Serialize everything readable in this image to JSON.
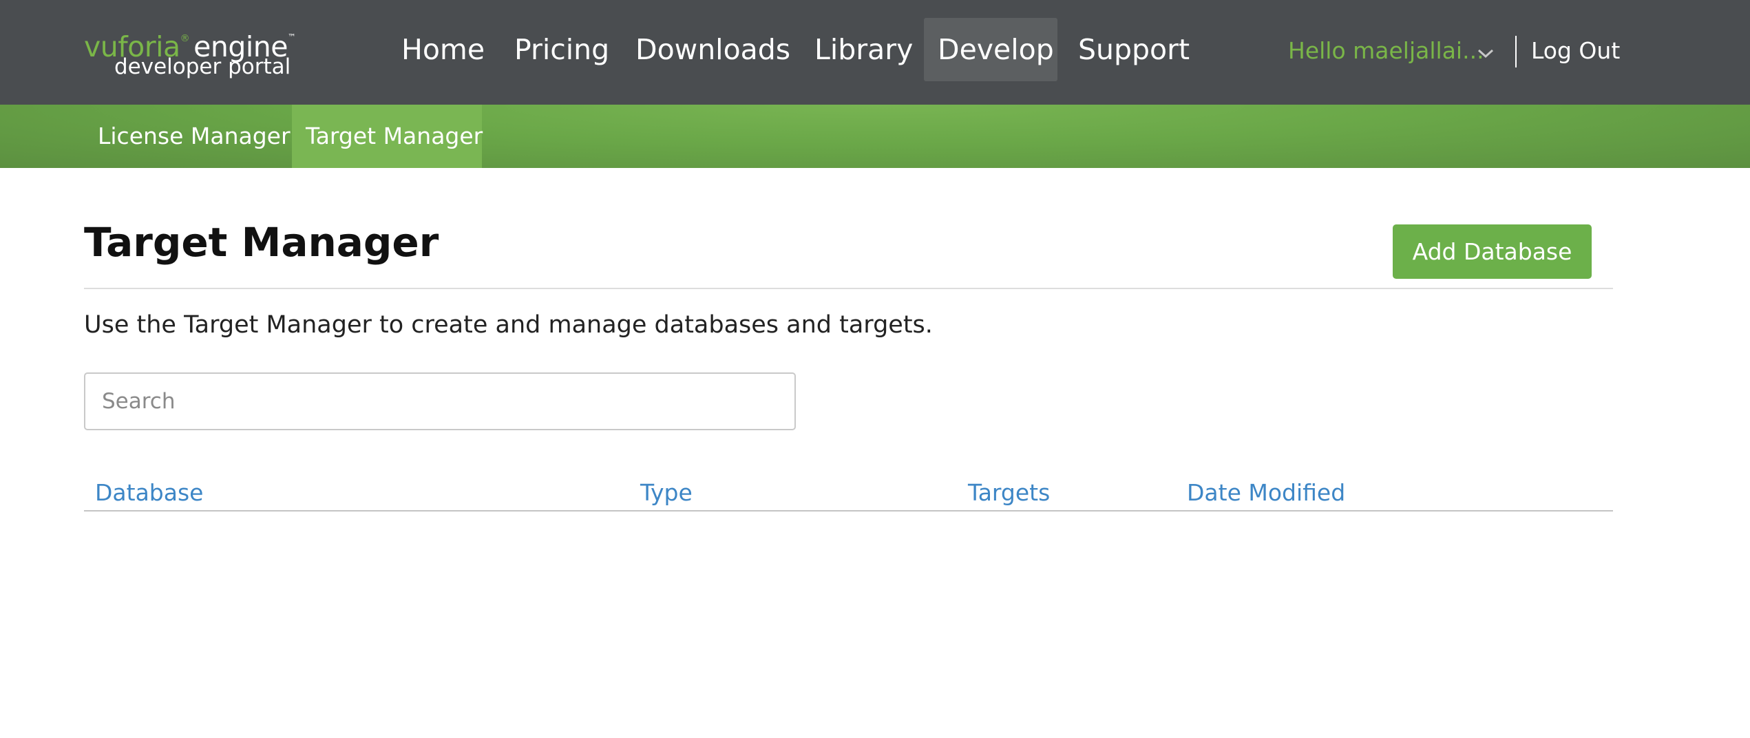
{
  "logo": {
    "brand": "vuforia",
    "registered": "®",
    "product": "engine",
    "trademark": "™",
    "subtitle": "developer portal",
    "brand_color": "#7ab648"
  },
  "nav": {
    "items": [
      {
        "label": "Home",
        "active": false
      },
      {
        "label": "Pricing",
        "active": false
      },
      {
        "label": "Downloads",
        "active": false
      },
      {
        "label": "Library",
        "active": false
      },
      {
        "label": "Develop",
        "active": true
      },
      {
        "label": "Support",
        "active": false
      }
    ],
    "background": "#4a4d50"
  },
  "user": {
    "greeting": "Hello maeljallai...",
    "dropdown_icon": "chevron-down-icon",
    "logout_label": "Log Out"
  },
  "subnav": {
    "items": [
      {
        "label": "License Manager",
        "active": false
      },
      {
        "label": "Target Manager",
        "active": true
      }
    ],
    "background": "#6aa748"
  },
  "main": {
    "title": "Target Manager",
    "add_button_label": "Add Database",
    "add_button_color": "#6cb04a",
    "description": "Use the Target Manager to create and manage databases and targets.",
    "search": {
      "placeholder": "Search",
      "value": ""
    },
    "table": {
      "columns": [
        "Database",
        "Type",
        "Targets",
        "Date Modified"
      ],
      "header_color": "#3d86c6",
      "rows": []
    }
  }
}
